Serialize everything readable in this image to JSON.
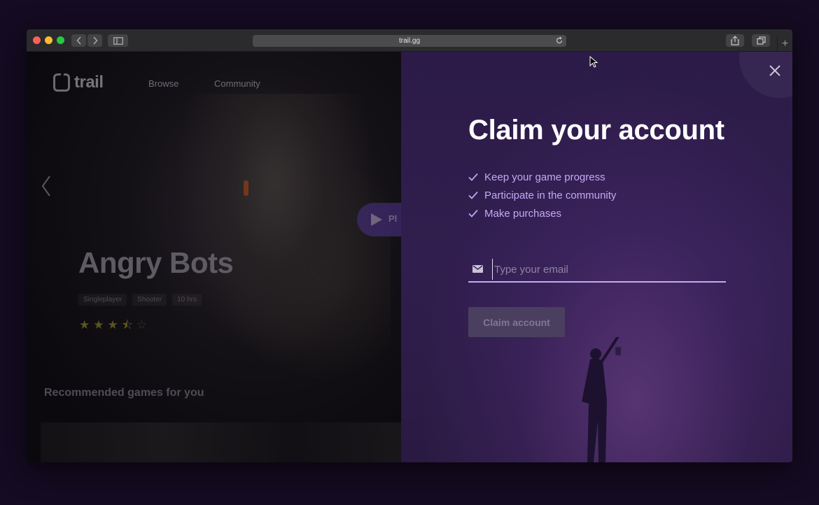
{
  "browser": {
    "url": "trail.gg",
    "new_tab_label": "+"
  },
  "site": {
    "logo_text": "trail",
    "nav": {
      "browse": "Browse",
      "community": "Community"
    },
    "play_label": "Pl",
    "game_title": "Angry Bots",
    "tags": [
      "Singleplayer",
      "Shooter",
      "10 hrs"
    ],
    "rating": 3.5,
    "recommended_title": "Recommended games for you"
  },
  "modal": {
    "title": "Claim your account",
    "benefits": [
      "Keep your game progress",
      "Participate in the community",
      "Make purchases"
    ],
    "email_placeholder": "Type your email",
    "email_value": "",
    "claim_button": "Claim account"
  },
  "colors": {
    "accent": "#c4a9f3",
    "modal_bg": "#2c1b48",
    "button_disabled": "#4a3f5f"
  },
  "icons": [
    "back-icon",
    "forward-icon",
    "sidebar-icon",
    "reload-icon",
    "share-icon",
    "tabs-icon",
    "close-icon",
    "check-icon",
    "mail-icon",
    "chevron-left-icon",
    "play-icon",
    "star-icon"
  ]
}
